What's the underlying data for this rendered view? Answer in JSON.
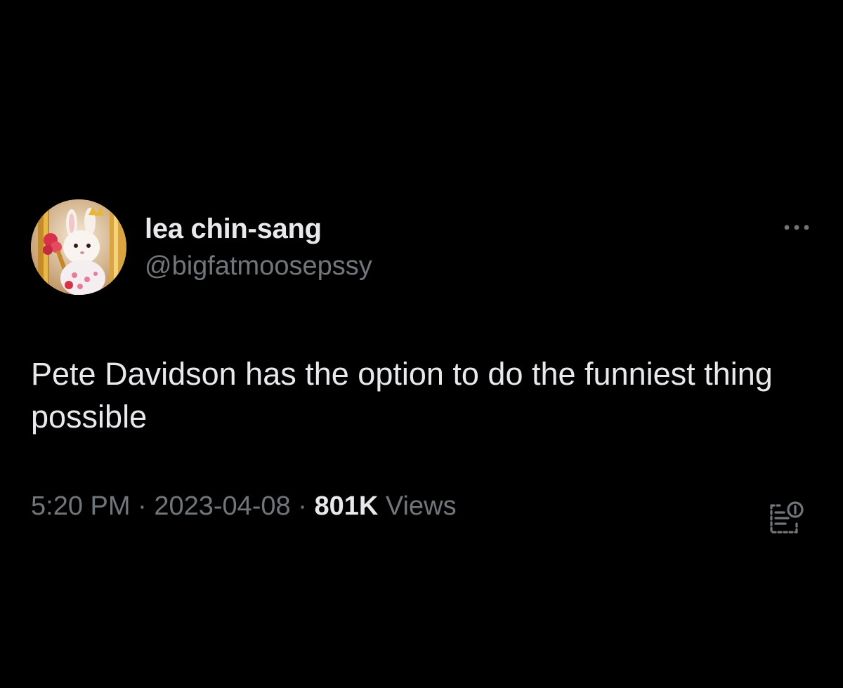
{
  "tweet": {
    "author": {
      "display_name": "lea chin-sang",
      "handle": "@bigfatmoosepssy",
      "avatar_icon": "avatar-photo"
    },
    "more_icon": "more-horizontal-icon",
    "text": "Pete Davidson has the option to do the funniest thing possible",
    "meta": {
      "time": "5:20 PM",
      "separator": " · ",
      "date": "2023-04-08",
      "views_count": "801K",
      "views_label": " Views"
    },
    "analytics_icon": "analytics-icon"
  },
  "colors": {
    "background": "#000000",
    "primary_text": "#e7e9ea",
    "secondary_text": "#71767b"
  }
}
